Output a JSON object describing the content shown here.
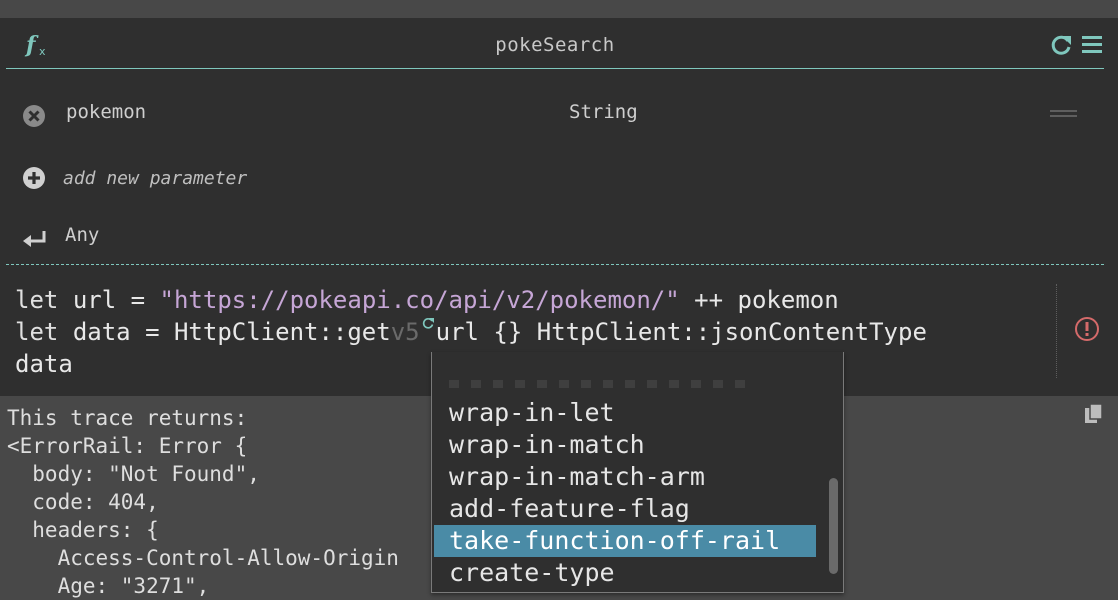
{
  "function": {
    "name": "pokeSearch"
  },
  "parameters": [
    {
      "name": "pokemon",
      "type": "String"
    }
  ],
  "add_parameter_label": "add new parameter",
  "return_type": "Any",
  "code": {
    "line1": {
      "kw": "let",
      "var": "url",
      "eq": "=",
      "str": "\"https://pokeapi.co/api/v2/pokemon/\"",
      "op": "++",
      "arg": "pokemon"
    },
    "line2": {
      "kw": "let",
      "var": "data",
      "eq": "=",
      "fn": "HttpClient::get",
      "ver": "v5",
      "rest": "url {} HttpClient::jsonContentType"
    },
    "line3": "data"
  },
  "trace": {
    "lines": [
      "This trace returns:",
      "<ErrorRail: Error {",
      "  body: \"Not Found\",",
      "  code: 404,",
      "  headers: {",
      "    Access-Control-Allow-Origin",
      "    Age: \"3271\","
    ]
  },
  "autocomplete": {
    "items": [
      "wrap-in-let",
      "wrap-in-match",
      "wrap-in-match-arm",
      "add-feature-flag",
      "take-function-off-rail",
      "create-type"
    ],
    "selected": "take-function-off-rail"
  },
  "colors": {
    "accent": "#7fc7bd",
    "selection": "#4a8ba6",
    "string": "#c6a6d6",
    "error": "#d46a6a"
  },
  "icons": [
    "function-icon",
    "refresh-icon",
    "menu-icon",
    "remove-param-icon",
    "add-param-icon",
    "return-icon",
    "error-icon",
    "copy-icon"
  ]
}
